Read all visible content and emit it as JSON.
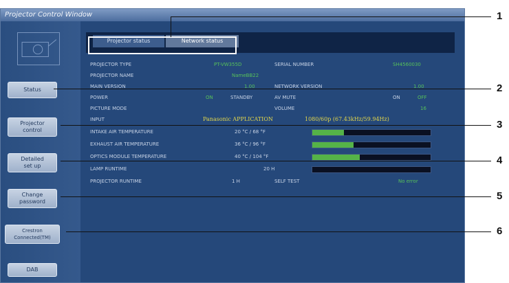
{
  "window": {
    "title": "Projector Control Window"
  },
  "sidebar": {
    "buttons": [
      {
        "label": "Status"
      },
      {
        "label": "Projector\ncontrol"
      },
      {
        "label": "Detailed\nset up"
      },
      {
        "label": "Change\npassword"
      },
      {
        "label": "Crestron\nConnected(TM)"
      },
      {
        "label": "DAB"
      }
    ]
  },
  "tabs": [
    {
      "label": "Projector status"
    },
    {
      "label": "Network status"
    }
  ],
  "status": {
    "projector_type": {
      "label": "PROJECTOR TYPE",
      "value": "PT-VW355D"
    },
    "serial_number": {
      "label": "SERIAL NUMBER",
      "value": "SH4560030"
    },
    "projector_name": {
      "label": "PROJECTOR NAME",
      "value": "NameBB22"
    },
    "main_version": {
      "label": "MAIN VERSION",
      "value": "1.00"
    },
    "network_version": {
      "label": "NETWORK VERSION",
      "value": "1.00"
    },
    "power": {
      "label": "POWER",
      "value": "ON",
      "value2": "STANDBY"
    },
    "av_mute": {
      "label": "AV MUTE",
      "value": "ON",
      "value2": "OFF"
    },
    "picture_mode": {
      "label": "PICTURE MODE",
      "value": ""
    },
    "volume": {
      "label": "VOLUME",
      "value": "16"
    },
    "input": {
      "label": "INPUT",
      "source": "Panasonic APPLICATION",
      "signal": "1080/60p (67.43kHz/59.94Hz)"
    },
    "intake_temp": {
      "label": "INTAKE AIR TEMPERATURE",
      "value": "20 °C / 68 °F",
      "level": 0.27
    },
    "exhaust_temp": {
      "label": "EXHAUST AIR TEMPERATURE",
      "value": "36 °C / 96 °F",
      "level": 0.35
    },
    "optics_temp": {
      "label": "OPTICS MODULE TEMPERATURE",
      "value": "40 °C / 104 °F",
      "level": 0.4
    },
    "lamp_runtime": {
      "label": "LAMP RUNTIME",
      "value": "20 H",
      "level": 0.0
    },
    "projector_runtime": {
      "label": "PROJECTOR RUNTIME",
      "value": "1 H"
    },
    "self_test": {
      "label": "SELF TEST",
      "value": "No error"
    }
  },
  "callouts": [
    "1",
    "2",
    "3",
    "4",
    "5",
    "6"
  ]
}
